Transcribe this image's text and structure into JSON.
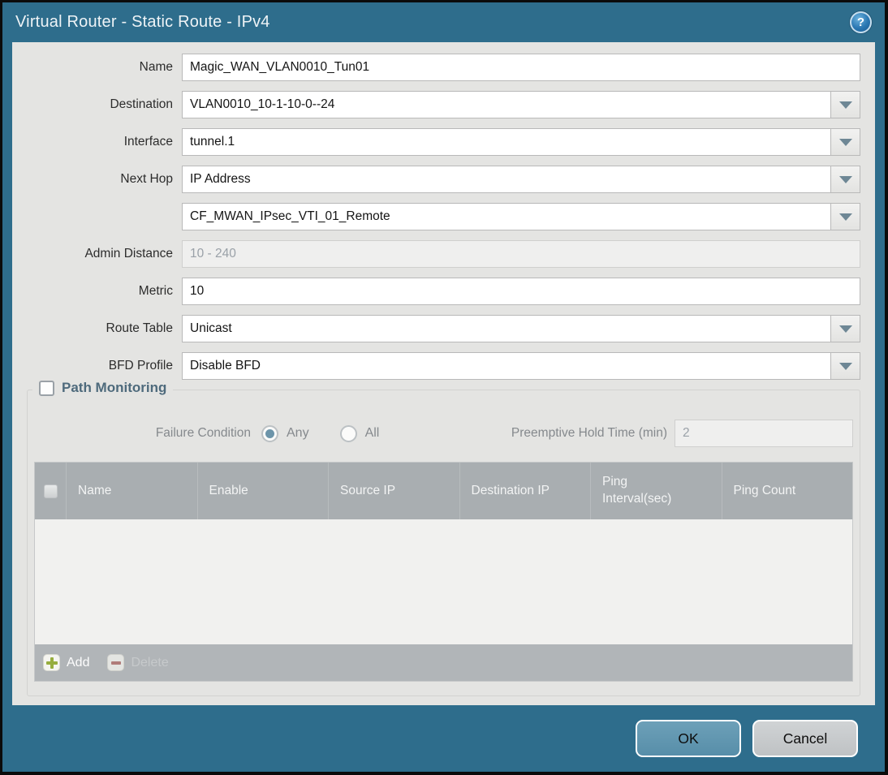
{
  "titlebar": {
    "title": "Virtual Router - Static Route - IPv4",
    "help_icon": "?"
  },
  "form": {
    "name": {
      "label": "Name",
      "value": "Magic_WAN_VLAN0010_Tun01"
    },
    "destination": {
      "label": "Destination",
      "value": "VLAN0010_10-1-10-0--24"
    },
    "interface": {
      "label": "Interface",
      "value": "tunnel.1"
    },
    "next_hop": {
      "label": "Next Hop",
      "value": "IP Address"
    },
    "next_hop_address": {
      "value": "CF_MWAN_IPsec_VTI_01_Remote"
    },
    "admin_distance": {
      "label": "Admin Distance",
      "value": "",
      "placeholder": "10 - 240"
    },
    "metric": {
      "label": "Metric",
      "value": "10"
    },
    "route_table": {
      "label": "Route Table",
      "value": "Unicast"
    },
    "bfd_profile": {
      "label": "BFD Profile",
      "value": "Disable BFD"
    }
  },
  "path_monitoring": {
    "label": "Path Monitoring",
    "checked": false,
    "failure_condition": {
      "label": "Failure Condition",
      "options": [
        {
          "label": "Any",
          "selected": true
        },
        {
          "label": "All",
          "selected": false
        }
      ]
    },
    "preemptive_hold_time": {
      "label": "Preemptive Hold Time (min)",
      "value": "2"
    },
    "table": {
      "headers": [
        "Name",
        "Enable",
        "Source IP",
        "Destination IP",
        "Ping Interval(sec)",
        "Ping Count"
      ],
      "rows": []
    },
    "toolbar": {
      "add_label": "Add",
      "delete_label": "Delete"
    }
  },
  "footer": {
    "ok_label": "OK",
    "cancel_label": "Cancel"
  },
  "colors": {
    "chrome_teal": "#2e6d8c",
    "content_bg": "#e4e4e2",
    "table_header_bg": "#a9aeb1",
    "ok_button": "#5f93ad",
    "cancel_button": "#c7cacc",
    "radio_selected": "#6d95aa",
    "add_icon_green": "#96ad3e",
    "delete_icon_red": "#b06a66",
    "group_label": "#4e6a7c"
  }
}
